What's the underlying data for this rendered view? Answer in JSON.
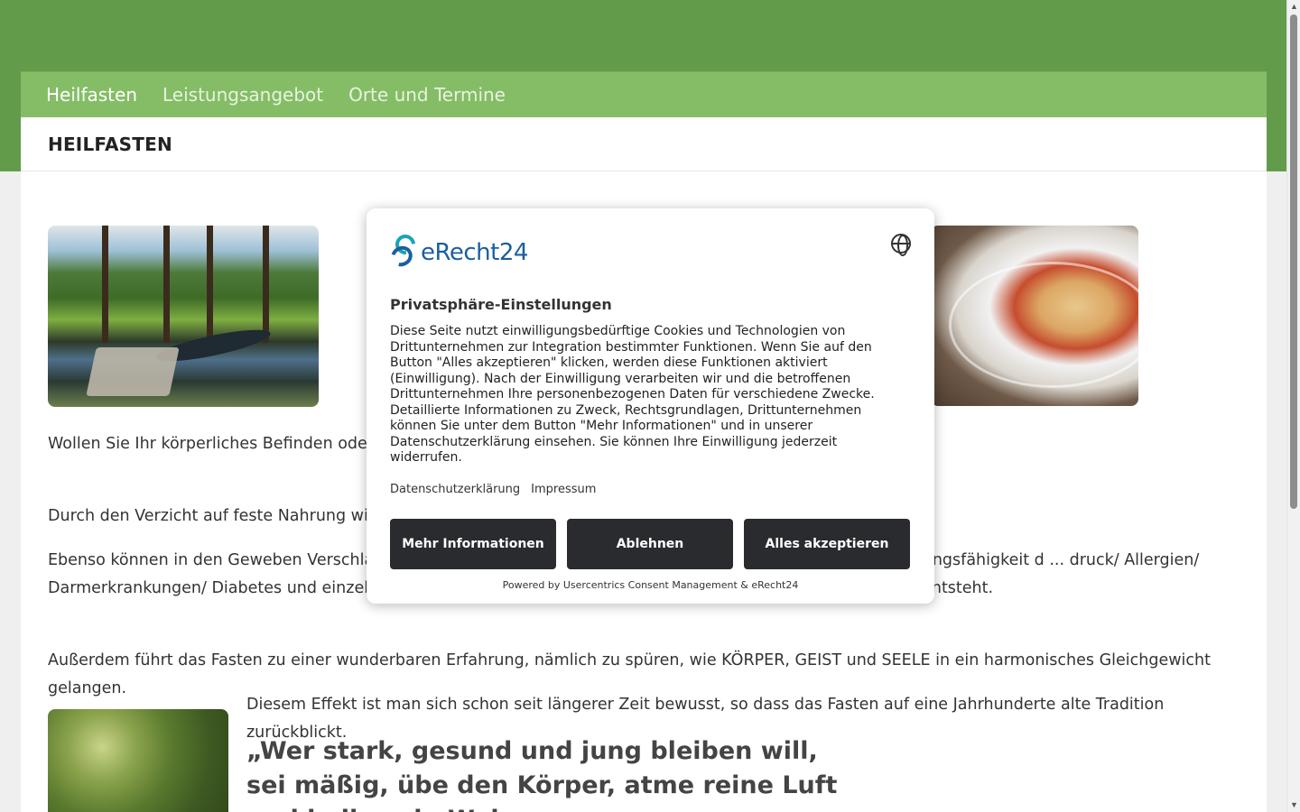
{
  "nav": {
    "items": [
      {
        "label": "Heilfasten"
      },
      {
        "label": "Leistungsangebot"
      },
      {
        "label": "Orte und Termine"
      }
    ]
  },
  "page": {
    "title": "HEILFASTEN"
  },
  "content": {
    "p1": "Wollen Sie Ihr körperliches Befinden oder Ihre ... ur ein sehr guter und effizienter Weg hierzu.",
    "p2": "Durch den Verzicht auf feste Nahrung wird de",
    "p3": "Ebenso können in den Geweben Verschlacku ... keitsstörungen reduziert und das Wohlbefinden sowie die Leistungsfähigkeit d ... druck/ Allergien/ Darmerkrankungen/ Diabetes und einzelnen anderen Stoffwechselerkrankungen sogar ein positiver Heileffekt entsteht.",
    "p4": "Außerdem führt das Fasten zu einer wunderbaren Erfahrung, nämlich zu spüren, wie KÖRPER, GEIST und SEELE in ein harmonisches Gleichgewicht gelangen.",
    "p5": "Diesem Effekt ist man sich schon seit längerer Zeit bewusst, so dass das Fasten auf eine Jahrhunderte alte Tradition zurückblickt.",
    "quote": "„Wer stark, gesund und jung bleiben will, sei mäßig, übe den Körper, atme reine Luft und heile sein Weh"
  },
  "consent": {
    "logo_text": "eRecht24",
    "title": "Privatsphäre-Einstellungen",
    "text": "Diese Seite nutzt einwilligungsbedürftige Cookies und Technologien von Drittunternehmen zur Integration bestimmter Funktionen. Wenn Sie auf den Button \"Alles akzeptieren\" klicken, werden diese Funktionen aktiviert (Einwilligung). Nach der Einwilligung verarbeiten wir und die betroffenen Drittunternehmen Ihre personenbezogenen Daten für verschiedene Zwecke. Detaillierte Informationen zu Zweck, Rechtsgrundlagen, Drittunternehmen können Sie unter dem Button \"Mehr Informationen\" und in unserer Datenschutzerklärung einsehen. Sie können Ihre Einwilligung jederzeit widerrufen.",
    "link_privacy": "Datenschutzerklärung",
    "link_imprint": "Impressum",
    "btn_more": "Mehr Informationen",
    "btn_decline": "Ablehnen",
    "btn_accept": "Alles akzeptieren",
    "powered": "Powered by Usercentrics Consent Management & eRecht24"
  },
  "icons": {
    "globe": "globe-icon",
    "logo": "erecht24-logo-icon"
  },
  "colors": {
    "top_band": "#629c4b",
    "navbar": "#84bd66",
    "button_dark": "#2a2b2f",
    "logo_blue": "#1a5f9e"
  }
}
